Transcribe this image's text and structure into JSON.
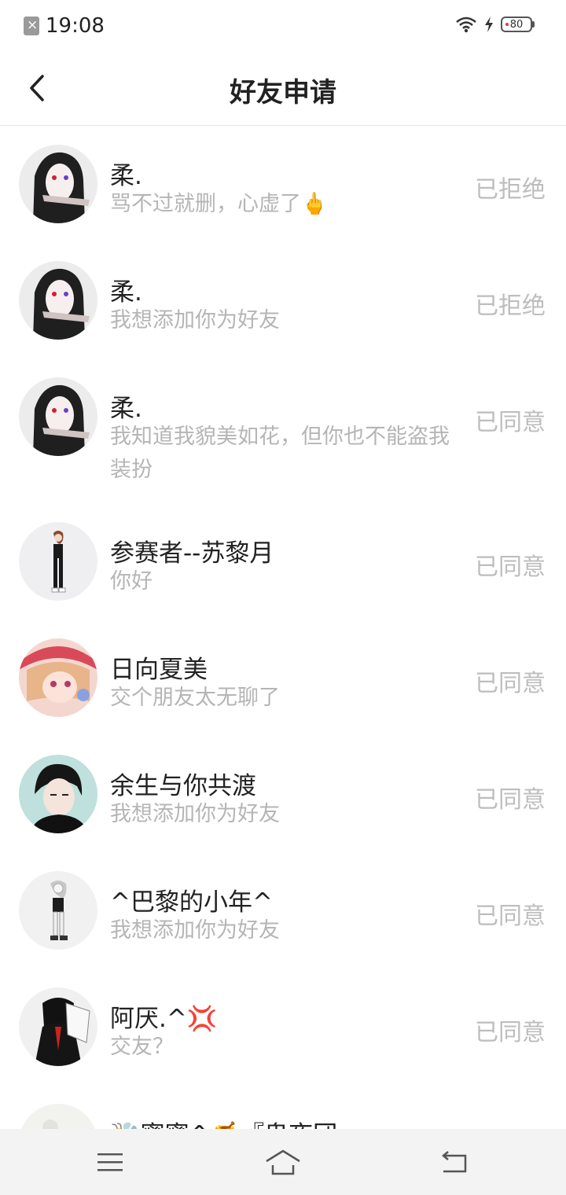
{
  "status_bar": {
    "time": "19:08",
    "battery": "80"
  },
  "header": {
    "title": "好友申请"
  },
  "requests": [
    {
      "name": "柔.",
      "message": "骂不过就删，心虚了🖕",
      "status": "已拒绝"
    },
    {
      "name": "柔.",
      "message": "我想添加你为好友",
      "status": "已拒绝"
    },
    {
      "name": "柔.",
      "message": "我知道我貌美如花，但你也不能盗我装扮",
      "status": "已同意"
    },
    {
      "name": "参赛者--苏黎月",
      "message": "你好",
      "status": "已同意"
    },
    {
      "name": "日向夏美",
      "message": "交个朋友太无聊了",
      "status": "已同意"
    },
    {
      "name": "余生与你共渡",
      "message": "我想添加你为好友",
      "status": "已同意"
    },
    {
      "name": "^巴黎的小年^",
      "message": "我想添加你为好友",
      "status": "已同意"
    },
    {
      "name": "阿厌.^💢",
      "message": "交友？",
      "status": "已同意"
    },
    {
      "name": "🐝蜜蜜^🍯『鬼夜団』",
      "message": "",
      "status": ""
    }
  ]
}
